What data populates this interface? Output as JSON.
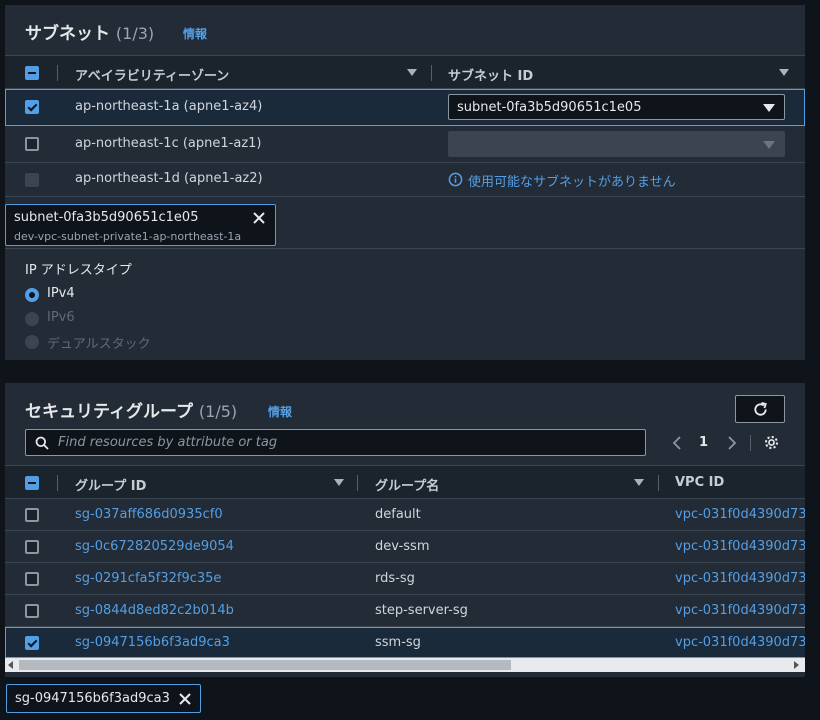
{
  "subnets": {
    "title": "サブネット",
    "count": "(1/3)",
    "info": "情報",
    "columns": [
      "アベイラビリティーゾーン",
      "サブネット ID"
    ],
    "rows": [
      {
        "az": "ap-northeast-1a (apne1-az4)",
        "checked": true,
        "subnet": "subnet-0fa3b5d90651c1e05"
      },
      {
        "az": "ap-northeast-1c (apne1-az1)",
        "checked": false,
        "subnet": ""
      },
      {
        "az": "ap-northeast-1d (apne1-az2)",
        "checked": false,
        "note": "使用可能なサブネットがありません"
      }
    ],
    "token": {
      "id": "subnet-0fa3b5d90651c1e05",
      "name": "dev-vpc-subnet-private1-ap-northeast-1a"
    },
    "ip_type": {
      "label": "IP アドレスタイプ",
      "options": [
        "IPv4",
        "IPv6",
        "デュアルスタック"
      ],
      "selected": "IPv4"
    }
  },
  "security_groups": {
    "title": "セキュリティグループ",
    "count": "(1/5)",
    "info": "情報",
    "search_placeholder": "Find resources by attribute or tag",
    "page": "1",
    "columns": [
      "グループ ID",
      "グループ名",
      "VPC ID"
    ],
    "rows": [
      {
        "id": "sg-037aff686d0935cf0",
        "name": "default",
        "vpc": "vpc-031f0d4390d73",
        "checked": false
      },
      {
        "id": "sg-0c672820529de9054",
        "name": "dev-ssm",
        "vpc": "vpc-031f0d4390d73",
        "checked": false
      },
      {
        "id": "sg-0291cfa5f32f9c35e",
        "name": "rds-sg",
        "vpc": "vpc-031f0d4390d73",
        "checked": false
      },
      {
        "id": "sg-0844d8ed82c2b014b",
        "name": "step-server-sg",
        "vpc": "vpc-031f0d4390d73",
        "checked": false
      },
      {
        "id": "sg-0947156b6f3ad9ca3",
        "name": "ssm-sg",
        "vpc": "vpc-031f0d4390d73",
        "checked": true
      }
    ],
    "token": "sg-0947156b6f3ad9ca3"
  },
  "colors": {
    "accent": "#539fe5",
    "panel": "#232b36",
    "background": "#0f141a"
  }
}
